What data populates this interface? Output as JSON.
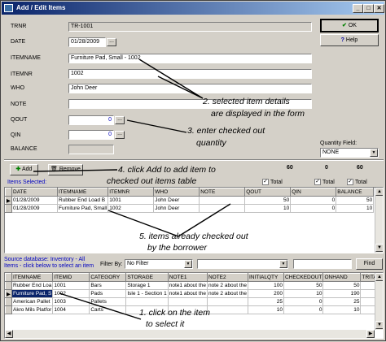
{
  "window": {
    "title": "Add / Edit Items"
  },
  "form": {
    "trnr": {
      "label": "TRNR",
      "value": "TR-1001"
    },
    "date": {
      "label": "DATE",
      "value": "01/28/2009"
    },
    "itemname": {
      "label": "ITEMNAME",
      "value": "Furniture Pad, Small - 1002"
    },
    "itemnr": {
      "label": "ITEMNR",
      "value": "1002"
    },
    "who": {
      "label": "WHO",
      "value": "John Deer"
    },
    "note": {
      "label": "NOTE",
      "value": ""
    },
    "qout": {
      "label": "QOUT",
      "value": "0"
    },
    "qin": {
      "label": "QIN",
      "value": "0"
    },
    "balance": {
      "label": "BALANCE",
      "value": ""
    }
  },
  "buttons": {
    "ok": "OK",
    "help": "Help",
    "add": "Add",
    "remove": "Remove",
    "find": "Find",
    "ellipsis": "..."
  },
  "quantity_field": {
    "label": "Quantity Field:",
    "value": "NONE"
  },
  "totals": {
    "qout": "60",
    "qin": "0",
    "balance": "60",
    "label": "Total"
  },
  "items_selected": {
    "label": "Items Selected:",
    "columns": [
      "DATE",
      "ITEMNAME",
      "ITEMNR",
      "WHO",
      "NOTE",
      "QOUT",
      "QIN",
      "BALANCE"
    ],
    "rows": [
      [
        "01/28/2009",
        "Rubber End Load B",
        "1001",
        "John Deer",
        "",
        "50",
        "0",
        "50"
      ],
      [
        "01/28/2009",
        "Furniture Pad, Small",
        "1002",
        "John Deer",
        "",
        "10",
        "0",
        "10"
      ]
    ]
  },
  "source": {
    "label_line1": "Source database: Inventory - All",
    "label_line2": "Items - click below to select an item",
    "filter_label": "Filter By:",
    "filter_value": "No Filter",
    "columns": [
      "ITEMNAME",
      "ITEMID",
      "CATEGORY",
      "STORAGE",
      "NOTE1",
      "NOTE2",
      "INITIALQTY",
      "CHECKEDOUT",
      "ONHAND",
      "TRITAB"
    ],
    "rows": [
      [
        "Rubber End Loa",
        "1001",
        "Bars",
        "Storage 1",
        "note1 about the",
        "note 2 about the",
        "100",
        "50",
        "50",
        ""
      ],
      [
        "Furniture Pad, S",
        "1002",
        "Pads",
        "Isle 1 - Section 1",
        "note1 about the",
        "note 2 about the",
        "200",
        "10",
        "190",
        ""
      ],
      [
        "American Pallet",
        "1003",
        "Pallets",
        "",
        "",
        "",
        "25",
        "0",
        "25",
        ""
      ],
      [
        "Akro Mils Platfor",
        "1004",
        "Carts",
        "",
        "",
        "",
        "10",
        "0",
        "10",
        ""
      ]
    ]
  },
  "annotations": {
    "a1": "1. click on the item",
    "a1b": "to select it",
    "a2": "2. selected item details",
    "a2b": "are displayed in the form",
    "a3": "3. enter checked out",
    "a3b": "quantity",
    "a4": "4. click Add to add item to",
    "a4b": "checked out items table",
    "a5": "5. items already checked out",
    "a5b": "by the borrower"
  }
}
